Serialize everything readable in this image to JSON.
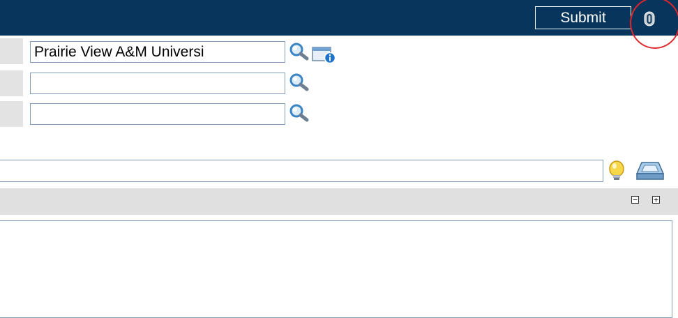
{
  "header": {
    "submit_label": "Submit",
    "attach_icon": "paperclip-icon",
    "highlight_color": "#e0262b",
    "bar_color": "#07355c"
  },
  "form": {
    "row1": {
      "value": "Prairie View A&M Universi",
      "search_icon": "magnifier-icon",
      "info_icon": "card-info-icon"
    },
    "row2": {
      "value": "",
      "search_icon": "magnifier-icon"
    },
    "row3": {
      "value": "",
      "search_icon": "magnifier-icon"
    }
  },
  "toolbar": {
    "wide_input_value": "",
    "hint_icon": "lightbulb-icon",
    "tray_icon": "inbox-tray-icon"
  },
  "section": {
    "collapse_symbol": "−",
    "expand_symbol": "+"
  }
}
